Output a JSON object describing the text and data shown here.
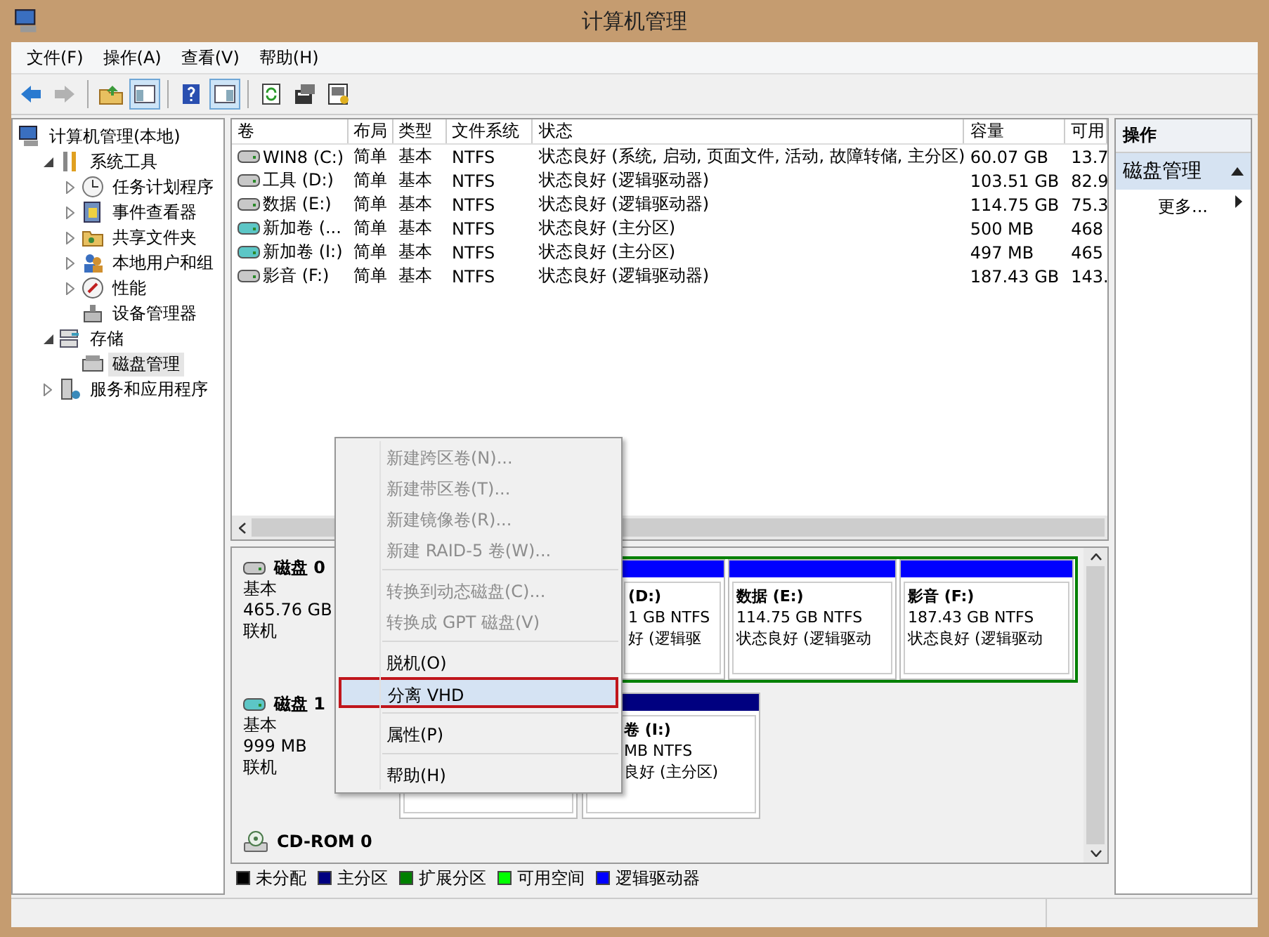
{
  "window": {
    "title": "计算机管理"
  },
  "menu_bar": [
    "文件(F)",
    "操作(A)",
    "查看(V)",
    "帮助(H)"
  ],
  "toolbar": [
    {
      "pressed": false,
      "disabled": false
    },
    {
      "pressed": false,
      "disabled": true
    },
    {
      "pressed": false
    },
    {
      "pressed": true
    },
    {
      "pressed": false
    },
    {
      "pressed": true
    },
    {
      "pressed": false
    },
    {
      "pressed": false
    },
    {
      "pressed": false
    }
  ],
  "tree": [
    {
      "label": "计算机管理(本地)",
      "selected": false,
      "children": [
        {
          "label": "系统工具",
          "expanded": true,
          "selected": false,
          "children": [
            {
              "label": "任务计划程序",
              "expanded": false,
              "selected": false
            },
            {
              "label": "事件查看器",
              "expanded": false,
              "selected": false
            },
            {
              "label": "共享文件夹",
              "expanded": false,
              "selected": false
            },
            {
              "label": "本地用户和组",
              "expanded": false,
              "selected": false
            },
            {
              "label": "性能",
              "expanded": false,
              "selected": false
            },
            {
              "label": "设备管理器",
              "selected": false
            }
          ]
        },
        {
          "label": "存储",
          "expanded": true,
          "selected": false,
          "children": [
            {
              "label": "磁盘管理",
              "selected": true
            }
          ]
        },
        {
          "label": "服务和应用程序",
          "expanded": false,
          "selected": false
        }
      ]
    }
  ],
  "table": {
    "columns": [
      "卷",
      "布局",
      "类型",
      "文件系统",
      "状态",
      "容量",
      "可用"
    ],
    "rows": [
      {
        "kind": "basic",
        "cells": [
          "WIN8 (C:)",
          "简单",
          "基本",
          "NTFS",
          "状态良好 (系统, 启动, 页面文件, 活动, 故障转储, 主分区)",
          "60.07 GB",
          "13.7"
        ]
      },
      {
        "kind": "basic",
        "cells": [
          "工具 (D:)",
          "简单",
          "基本",
          "NTFS",
          "状态良好 (逻辑驱动器)",
          "103.51 GB",
          "82.9"
        ]
      },
      {
        "kind": "basic",
        "cells": [
          "数据 (E:)",
          "简单",
          "基本",
          "NTFS",
          "状态良好 (逻辑驱动器)",
          "114.75 GB",
          "75.3"
        ]
      },
      {
        "kind": "virtual",
        "cells": [
          "新加卷 (...",
          "简单",
          "基本",
          "NTFS",
          "状态良好 (主分区)",
          "500 MB",
          "468"
        ]
      },
      {
        "kind": "virtual",
        "cells": [
          "新加卷 (I:)",
          "简单",
          "基本",
          "NTFS",
          "状态良好 (主分区)",
          "497 MB",
          "465"
        ]
      },
      {
        "kind": "basic",
        "cells": [
          "影音 (F:)",
          "简单",
          "基本",
          "NTFS",
          "状态良好 (逻辑驱动器)",
          "187.43 GB",
          "143."
        ]
      }
    ]
  },
  "disks": [
    {
      "name": "磁盘 0",
      "kind": "basic",
      "lines": [
        "基本",
        "465.76 GB",
        "联机"
      ],
      "partitions": [
        {
          "kind": "extended",
          "partitions": [
            {
              "kind": "logical",
              "lines": [
                "(D:)",
                "1 GB NTFS",
                "好 (逻辑驱"
              ]
            },
            {
              "kind": "logical",
              "lines": [
                "数据  (E:)",
                "114.75 GB NTFS",
                "状态良好 (逻辑驱动"
              ]
            },
            {
              "kind": "logical",
              "lines": [
                "影音  (F:)",
                "187.43 GB NTFS",
                "状态良好 (逻辑驱动"
              ]
            }
          ]
        }
      ]
    },
    {
      "name": "磁盘 1",
      "kind": "virtual",
      "lines": [
        "基本",
        "999 MB",
        "联机"
      ],
      "partitions": [
        {
          "kind": "blank"
        },
        {
          "kind": "primary",
          "lines": [
            "卷  (I:)",
            "MB NTFS",
            "良好 (主分区)"
          ]
        }
      ]
    },
    {
      "name": "CD-ROM 0",
      "kind": "cdrom"
    }
  ],
  "legend": [
    {
      "label": "未分配",
      "color": "#000000"
    },
    {
      "label": "主分区",
      "color": "#000080"
    },
    {
      "label": "扩展分区",
      "color": "#008000"
    },
    {
      "label": "可用空间",
      "color": "#00ff00"
    },
    {
      "label": "逻辑驱动器",
      "color": "#0000ff"
    }
  ],
  "actions": {
    "title": "操作",
    "section": {
      "label": "磁盘管理",
      "expanded": true
    },
    "items": [
      "更多..."
    ]
  },
  "context_menu": [
    {
      "kind": "item",
      "label": "新建跨区卷(N)...",
      "disabled": true,
      "selected": false
    },
    {
      "kind": "item",
      "label": "新建带区卷(T)...",
      "disabled": true,
      "selected": false
    },
    {
      "kind": "item",
      "label": "新建镜像卷(R)...",
      "disabled": true,
      "selected": false
    },
    {
      "kind": "item",
      "label": "新建 RAID-5 卷(W)...",
      "disabled": true,
      "selected": false
    },
    {
      "kind": "separator"
    },
    {
      "kind": "item",
      "label": "转换到动态磁盘(C)...",
      "disabled": true,
      "selected": false
    },
    {
      "kind": "item",
      "label": "转换成 GPT 磁盘(V)",
      "disabled": true,
      "selected": false
    },
    {
      "kind": "separator"
    },
    {
      "kind": "item",
      "label": "脱机(O)",
      "disabled": false,
      "selected": false
    },
    {
      "kind": "item",
      "label": "分离 VHD",
      "disabled": false,
      "selected": true
    },
    {
      "kind": "separator"
    },
    {
      "kind": "item",
      "label": "属性(P)",
      "disabled": false,
      "selected": false
    },
    {
      "kind": "separator"
    },
    {
      "kind": "item",
      "label": "帮助(H)",
      "disabled": false,
      "selected": false
    }
  ]
}
